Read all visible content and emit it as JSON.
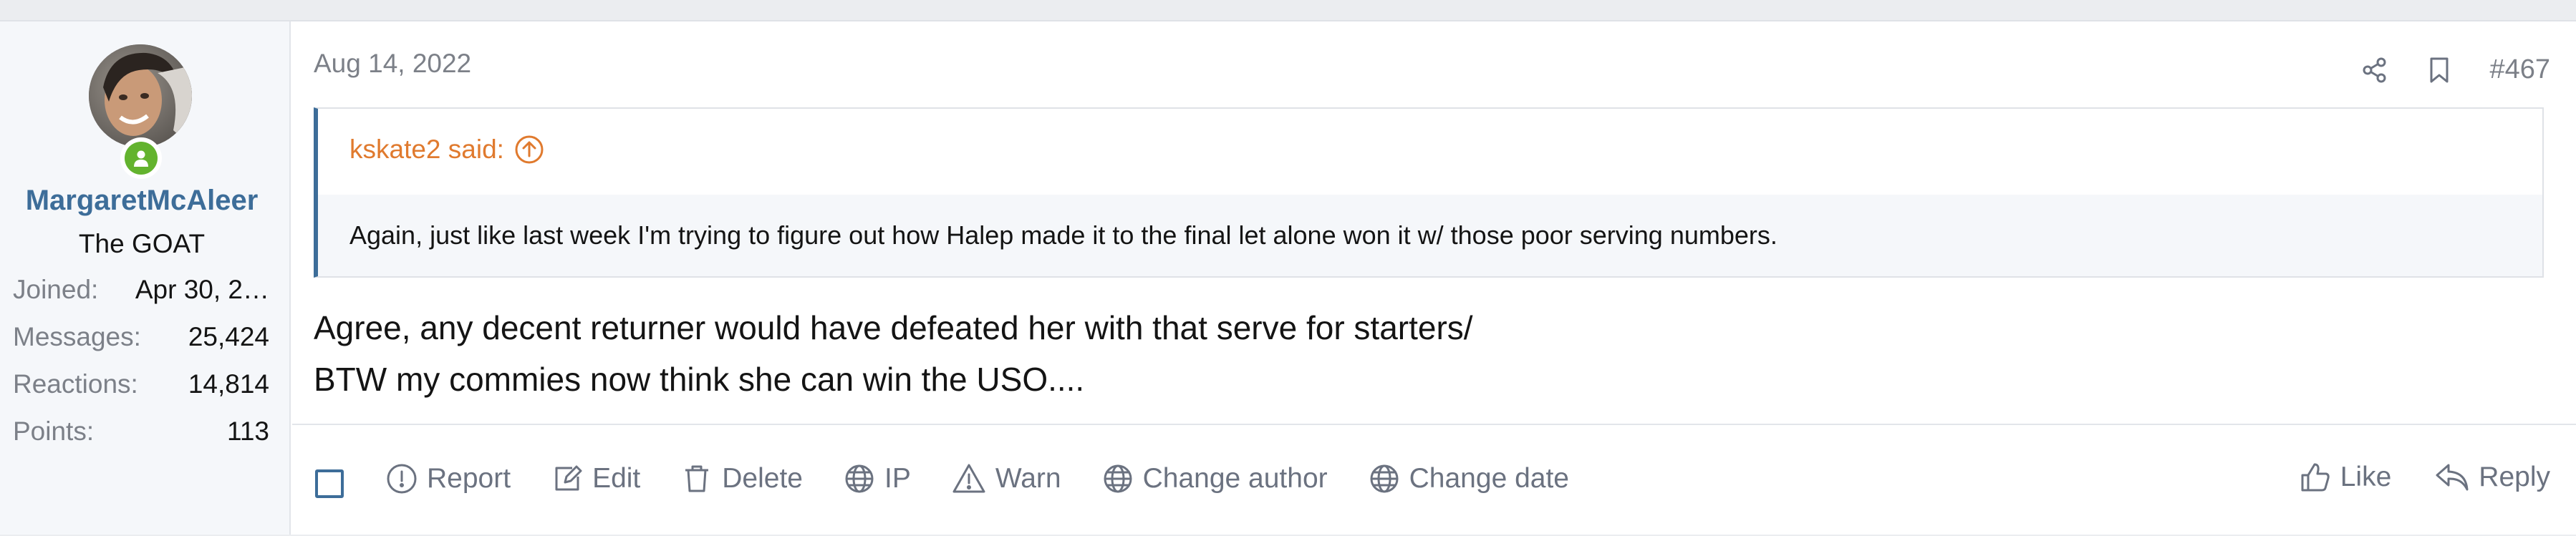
{
  "user": {
    "name": "MargaretMcAleer",
    "title": "The GOAT",
    "stats": [
      {
        "label": "Joined:",
        "value": "Apr 30, 2…"
      },
      {
        "label": "Messages:",
        "value": "25,424"
      },
      {
        "label": "Reactions:",
        "value": "14,814"
      },
      {
        "label": "Points:",
        "value": "113"
      }
    ],
    "avatar_icon": "user-avatar-photo",
    "online_icon": "online-status-icon"
  },
  "post": {
    "date": "Aug 14, 2022",
    "number": "#467",
    "quote": {
      "author_said": "kskate2 said:",
      "text": "Again, just like last week I'm trying to figure out how Halep made it to the final let alone won it w/ those poor serving numbers."
    },
    "message_lines": [
      "Agree, any decent returner would have defeated her with that serve for starters/",
      "BTW my commies now think she can win the USO...."
    ]
  },
  "actions": {
    "report": "Report",
    "edit": "Edit",
    "delete": "Delete",
    "ip": "IP",
    "warn": "Warn",
    "change_author": "Change author",
    "change_date": "Change date",
    "like": "Like",
    "reply": "Reply"
  },
  "colors": {
    "username": "#3d6d99",
    "quote_author": "#e07a2e",
    "online": "#63b32e",
    "action_text": "#6b7280"
  }
}
